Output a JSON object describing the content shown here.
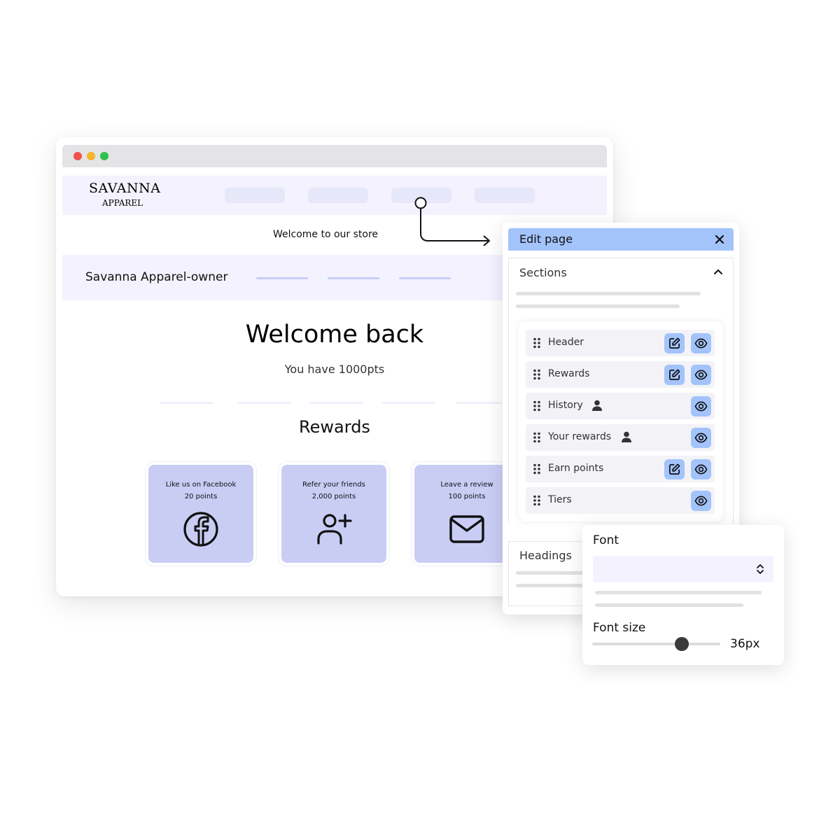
{
  "site": {
    "logo_main": "SAVANNA",
    "logo_sub": "APPAREL",
    "welcome_store": "Welcome to our store",
    "owner_name": "Savanna Apparel-owner",
    "welcome_back": "Welcome back",
    "points_text": "You have 1000pts",
    "rewards_title": "Rewards"
  },
  "reward_cards": [
    {
      "title": "Like us on Facebook",
      "points": "20 points",
      "icon": "facebook-icon"
    },
    {
      "title": "Refer your friends",
      "points": "2,000 points",
      "icon": "add-user-icon"
    },
    {
      "title": "Leave a review",
      "points": "100 points",
      "icon": "mail-icon"
    }
  ],
  "edit_panel": {
    "title": "Edit page",
    "sections_label": "Sections",
    "headings_label": "Headings",
    "items": [
      {
        "label": "Header",
        "editable": true,
        "person": false
      },
      {
        "label": "Rewards",
        "editable": true,
        "person": false
      },
      {
        "label": "History",
        "editable": false,
        "person": true
      },
      {
        "label": "Your rewards",
        "editable": false,
        "person": true
      },
      {
        "label": "Earn points",
        "editable": true,
        "person": false
      },
      {
        "label": "Tiers",
        "editable": false,
        "person": false
      }
    ]
  },
  "font_card": {
    "font_label": "Font",
    "font_size_label": "Font size",
    "font_size_value": "36px",
    "slider_fraction": 0.7
  },
  "colors": {
    "accent_blue": "#a3c3fb",
    "card_purple": "#c9cdf4",
    "header_tint": "#f3f2fe"
  }
}
